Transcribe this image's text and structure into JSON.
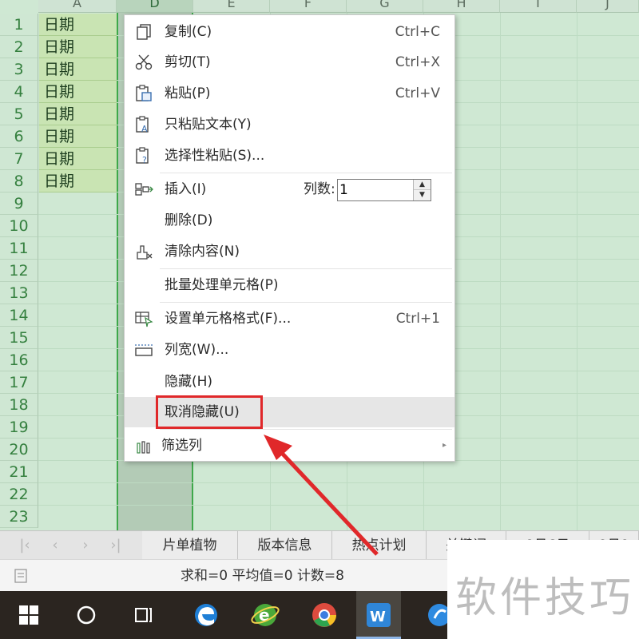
{
  "columns": [
    "A",
    "D",
    "E",
    "F",
    "G",
    "H",
    "I",
    "J"
  ],
  "rows": [
    "1",
    "2",
    "3",
    "4",
    "5",
    "6",
    "7",
    "8",
    "9",
    "10",
    "11",
    "12",
    "13",
    "14",
    "15",
    "16",
    "17",
    "18",
    "19",
    "20",
    "21",
    "22",
    "23"
  ],
  "cells_a": [
    "日期",
    "日期",
    "日期",
    "日期",
    "日期",
    "日期",
    "日期",
    "日期"
  ],
  "menu": {
    "copy": {
      "label": "复制(C)",
      "shortcut": "Ctrl+C"
    },
    "cut": {
      "label": "剪切(T)",
      "shortcut": "Ctrl+X"
    },
    "paste": {
      "label": "粘贴(P)",
      "shortcut": "Ctrl+V"
    },
    "paste_text": {
      "label": "只粘贴文本(Y)"
    },
    "paste_special": {
      "label": "选择性粘贴(S)..."
    },
    "insert": {
      "label": "插入(I)",
      "count_label": "列数:",
      "count_value": "1"
    },
    "delete": {
      "label": "删除(D)"
    },
    "clear": {
      "label": "清除内容(N)"
    },
    "batch": {
      "label": "批量处理单元格(P)"
    },
    "format": {
      "label": "设置单元格格式(F)...",
      "shortcut": "Ctrl+1"
    },
    "col_width": {
      "label": "列宽(W)..."
    },
    "hide": {
      "label": "隐藏(H)"
    },
    "unhide": {
      "label": "取消隐藏(U)"
    },
    "filter_col": {
      "label": "筛选列"
    }
  },
  "tabs": [
    "片单植物",
    "版本信息",
    "热点计划",
    "关键词",
    "8月6日",
    "8月9"
  ],
  "status": {
    "text": "求和=0  平均值=0  计数=8"
  },
  "watermark": "软件技巧",
  "colors": {
    "accent_green": "#3ea84a",
    "highlight_red": "#e0282a",
    "grid_bg": "#cfe8d3"
  }
}
